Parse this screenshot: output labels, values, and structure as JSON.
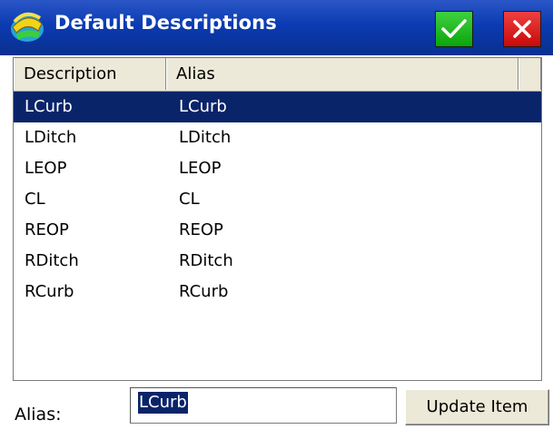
{
  "window": {
    "title": "Default Descriptions"
  },
  "titlebar": {
    "ok_icon": "check-icon",
    "cancel_icon": "close-icon",
    "ok_color": "#0aa60a",
    "cancel_color": "#c90a0a"
  },
  "table": {
    "columns": [
      "Description",
      "Alias"
    ],
    "rows": [
      {
        "description": "LCurb",
        "alias": "LCurb",
        "selected": true
      },
      {
        "description": "LDitch",
        "alias": "LDitch",
        "selected": false
      },
      {
        "description": "LEOP",
        "alias": "LEOP",
        "selected": false
      },
      {
        "description": "CL",
        "alias": "CL",
        "selected": false
      },
      {
        "description": "REOP",
        "alias": "REOP",
        "selected": false
      },
      {
        "description": "RDitch",
        "alias": "RDitch",
        "selected": false
      },
      {
        "description": "RCurb",
        "alias": "RCurb",
        "selected": false
      }
    ],
    "selection_color": "#0a246a"
  },
  "editor": {
    "label": "Alias:",
    "value": "LCurb",
    "update_label": "Update Item"
  }
}
